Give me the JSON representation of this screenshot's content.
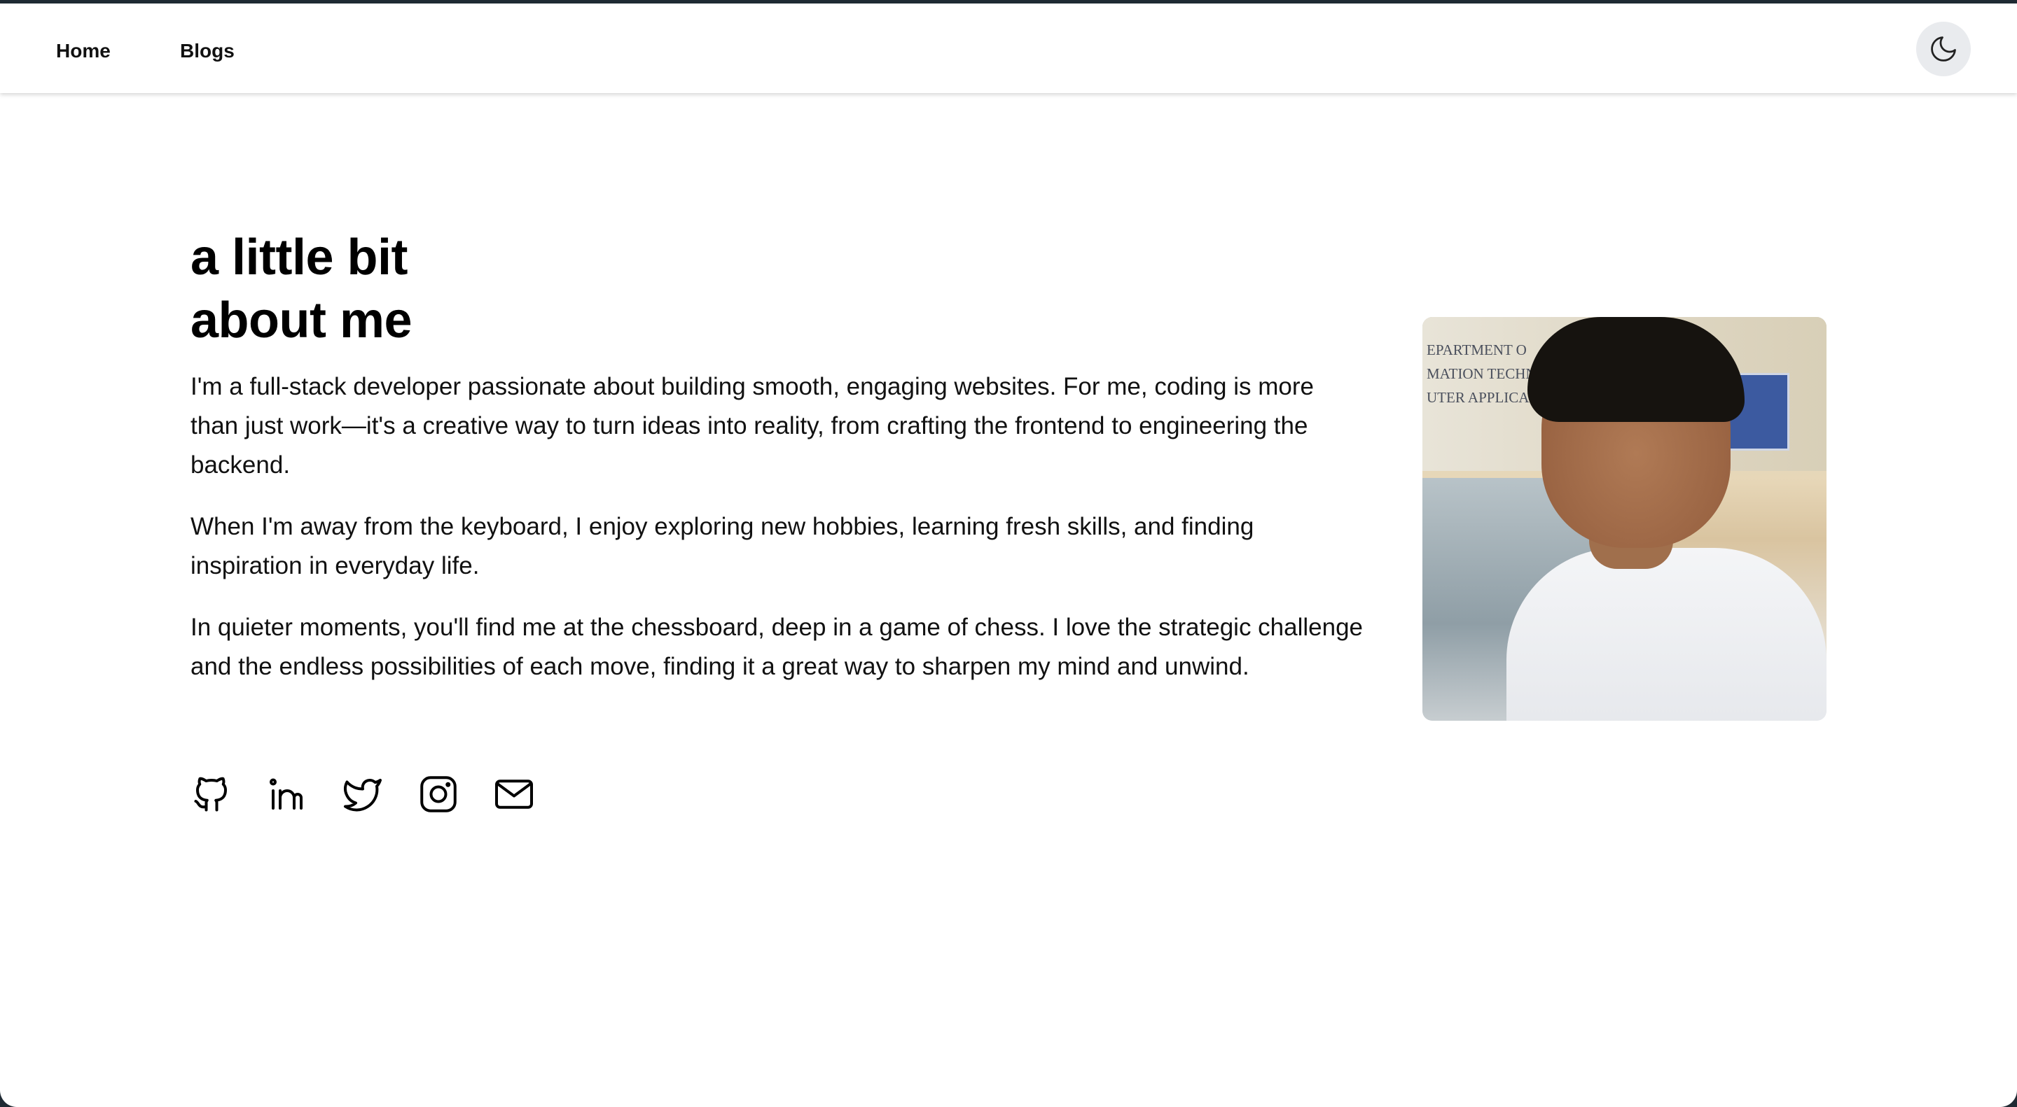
{
  "nav": {
    "home_label": "Home",
    "blogs_label": "Blogs",
    "theme_toggle_icon": "moon-icon"
  },
  "about": {
    "heading_line1": "a little bit",
    "heading_line2": "about me",
    "paragraphs": [
      "I'm a full-stack developer passionate about building smooth, engaging websites. For me, coding is more than just work—it's a creative way to turn ideas into reality, from crafting the frontend to engineering the backend.",
      "When I'm away from the keyboard, I enjoy exploring new hobbies, learning fresh skills, and finding inspiration in everyday life.",
      "In quieter moments, you'll find me at the chessboard, deep in a game of chess. I love the strategic challenge and the endless possibilities of each move, finding it a great way to sharpen my mind and unwind."
    ]
  },
  "socials": [
    {
      "icon": "github-icon"
    },
    {
      "icon": "linkedin-icon"
    },
    {
      "icon": "twitter-icon"
    },
    {
      "icon": "instagram-icon"
    },
    {
      "icon": "mail-icon"
    }
  ],
  "photo": {
    "background_text": [
      "EPARTMENT O",
      "MATION TECHN",
      "UTER APPLICA"
    ]
  },
  "colors": {
    "text": "#000000",
    "toggle_bg": "#e9ebee",
    "page_bg": "#ffffff",
    "frame": "#1f2a33"
  }
}
